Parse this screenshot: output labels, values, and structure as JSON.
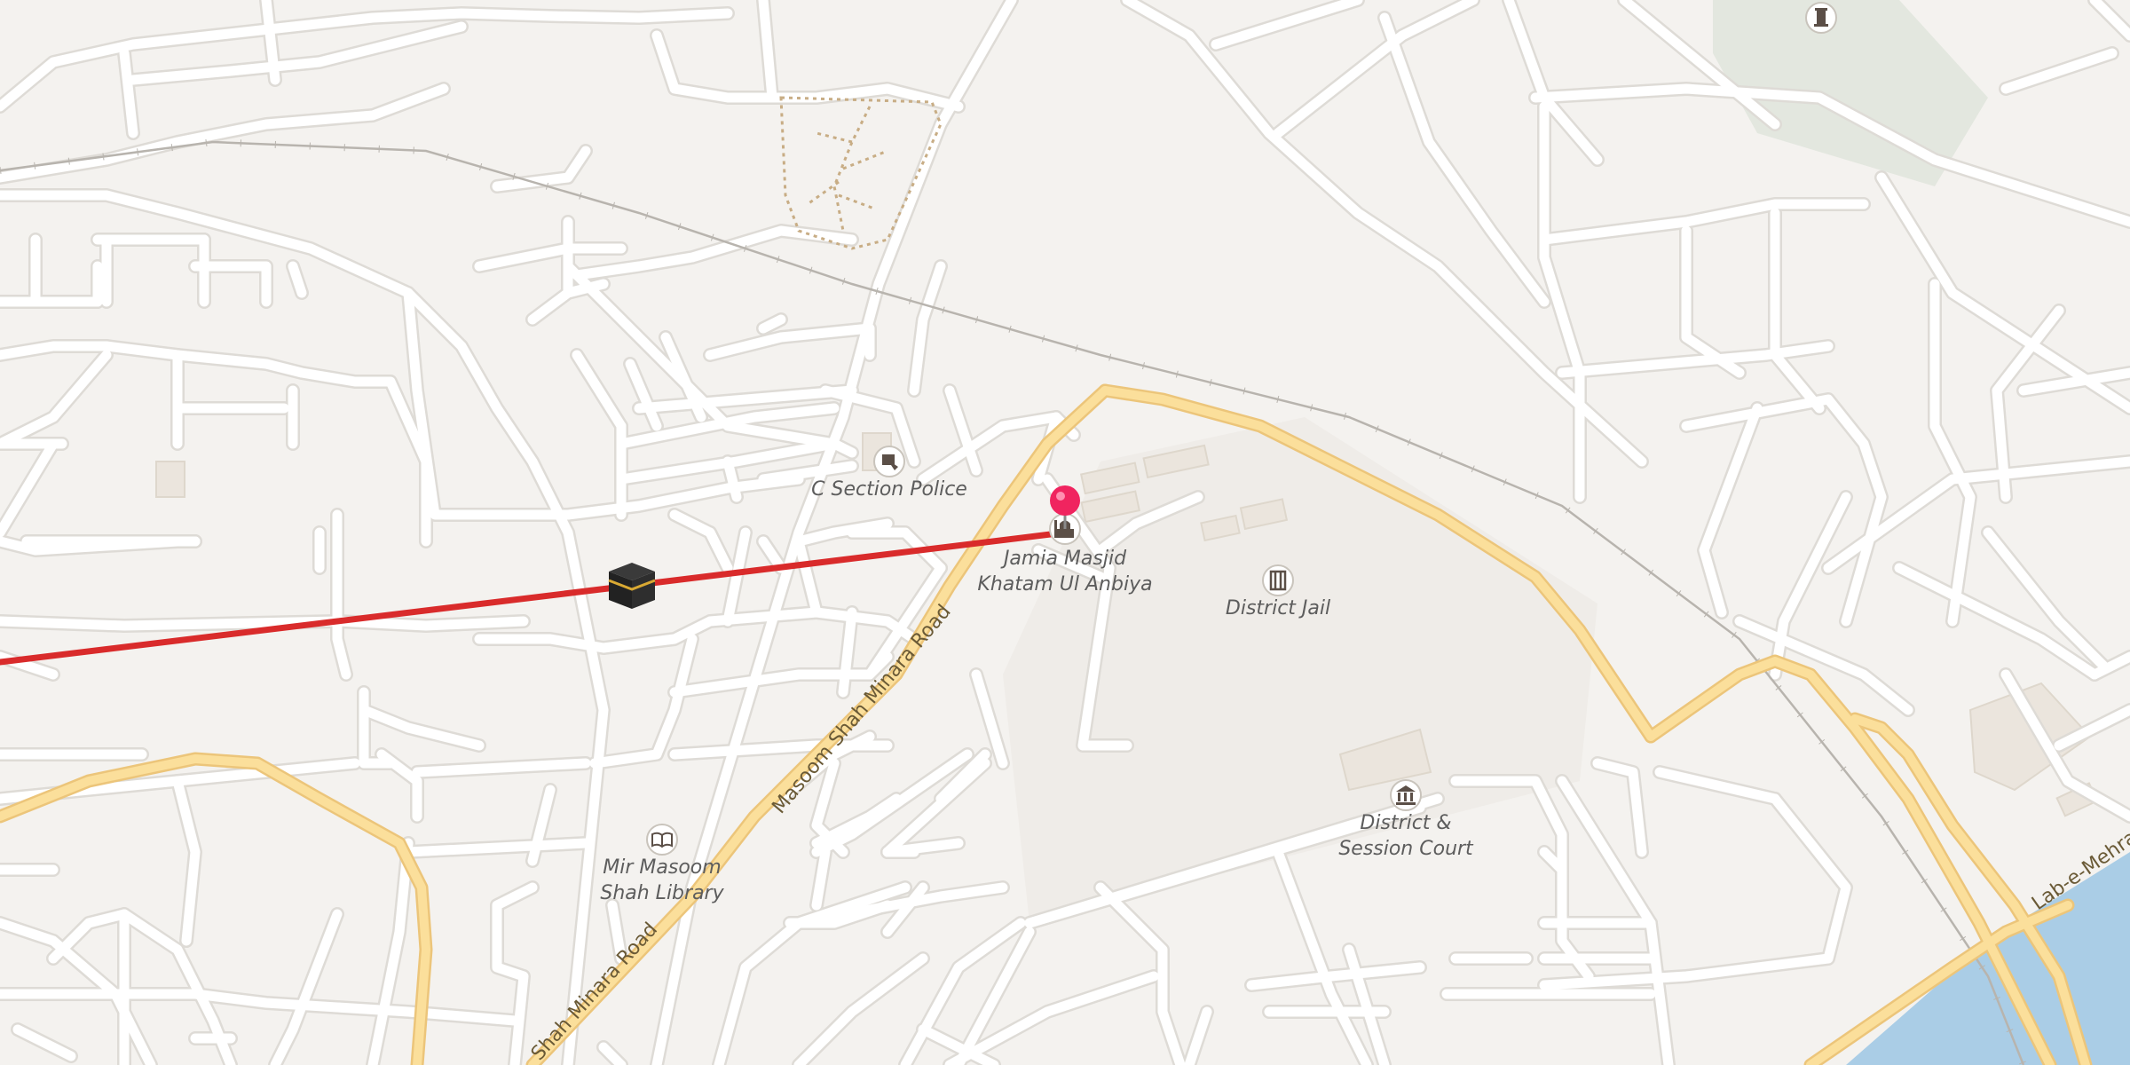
{
  "map": {
    "background": "#f4f2ef",
    "colors": {
      "minor_road": "#ffffff",
      "minor_road_casing": "#dedbd6",
      "major_road": "#fbdf9b",
      "major_road_casing": "#ecc57a",
      "water": "#aacde6",
      "park": "#e3e7df",
      "building": "#ebe5dd",
      "route": "#d92b2b",
      "pin": "#f0245f",
      "railway": "#b8b4ae"
    },
    "labels": {
      "police": "C Section Police",
      "mosque_line1": "Jamia Masjid",
      "mosque_line2": "Khatam Ul Anbiya",
      "jail": "District Jail",
      "library_line1": "Mir Masoom",
      "library_line2": "Shah Library",
      "court_line1": "District &",
      "court_line2": "Session Court",
      "road_upper": "Masoom Shah Minara Road",
      "road_lower": "Shah Minara Road",
      "road_river": "Lab-e-Mehran"
    },
    "icons": {
      "police": "police-icon",
      "mosque": "mosque-icon",
      "jail": "jail-icon",
      "library": "library-icon",
      "court": "courthouse-icon",
      "monument": "monument-icon",
      "kaaba": "kaaba-icon",
      "pin": "location-pin-icon"
    }
  }
}
